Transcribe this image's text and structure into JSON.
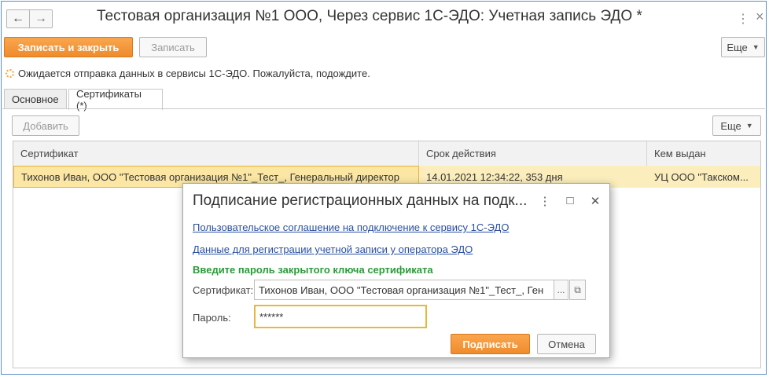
{
  "window": {
    "title": "Тестовая организация №1 ООО, Через сервис 1С-ЭДО: Учетная запись ЭДО *",
    "back_icon": "←",
    "forward_icon": "→",
    "menu_icon": "⋮",
    "close_icon": "×"
  },
  "toolbar": {
    "save_close_label": "Записать и закрыть",
    "save_label": "Записать",
    "more_label": "Еще"
  },
  "status": {
    "text": "Ожидается отправка данных в сервисы 1С-ЭДО. Пожалуйста, подождите."
  },
  "tabs": [
    {
      "label": "Основное"
    },
    {
      "label": "Сертификаты (*)"
    }
  ],
  "cert_toolbar": {
    "add_label": "Добавить",
    "more_label": "Еще"
  },
  "table": {
    "columns": [
      "Сертификат",
      "Срок действия",
      "Кем выдан"
    ],
    "rows": [
      [
        "Тихонов Иван, ООО \"Тестовая организация №1\"_Тест_, Генеральный директор",
        "14.01.2021 12:34:22, 353 дня",
        "УЦ ООО \"Такском..."
      ]
    ]
  },
  "dialog": {
    "title": "Подписание регистрационных данных на подк...",
    "menu_icon": "⋮",
    "maximize_icon": "□",
    "close_icon": "✕",
    "link_agreement": "Пользовательское соглашение на подключение к сервису 1С-ЭДО",
    "link_registration": "Данные для регистрации учетной записи у оператора ЭДО",
    "note": "Введите пароль закрытого ключа сертификата",
    "certificate_label": "Сертификат:",
    "certificate_value": "Тихонов Иван, ООО \"Тестовая организация №1\"_Тест_, Ген",
    "ellipsis": "...",
    "open_icon": "⧉",
    "password_label": "Пароль:",
    "password_value": "******",
    "sign_label": "Подписать",
    "cancel_label": "Отмена"
  },
  "colors": {
    "accent_orange": "#f08b2c",
    "selected_row": "#fbeebc",
    "link_blue": "#2a4fa1",
    "note_green": "#2a9a3a",
    "frame_border": "#5b8ec9"
  }
}
